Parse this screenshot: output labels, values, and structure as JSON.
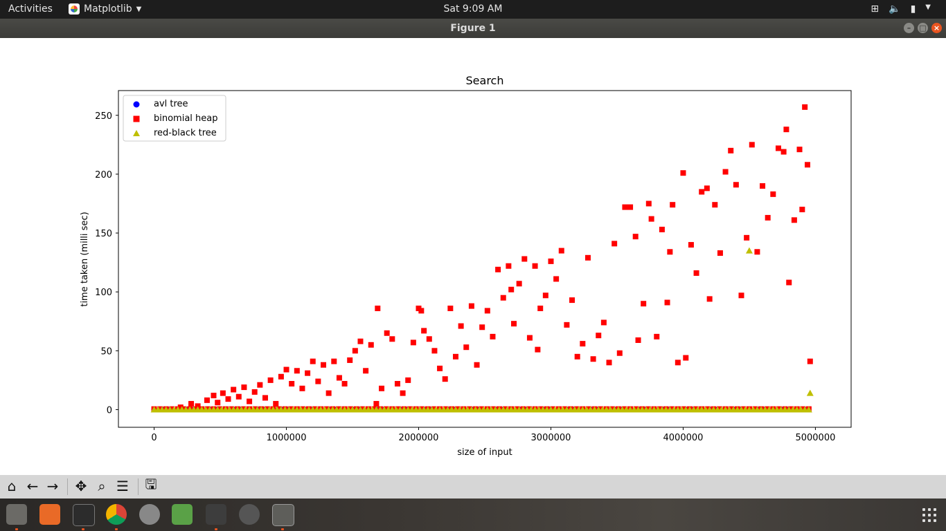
{
  "topbar": {
    "activities": "Activities",
    "app_name": "Matplotlib",
    "clock": "Sat  9:09 AM"
  },
  "window": {
    "title": "Figure 1"
  },
  "chart_data": {
    "type": "scatter",
    "title": "Search",
    "xlabel": "size of input",
    "ylabel": "time taken (milli sec)",
    "xlim": [
      -270000,
      5270000
    ],
    "ylim": [
      -15,
      271
    ],
    "xticks": [
      0,
      1000000,
      2000000,
      3000000,
      4000000,
      5000000
    ],
    "xtick_labels": [
      "0",
      "1000000",
      "2000000",
      "3000000",
      "4000000",
      "5000000"
    ],
    "yticks": [
      0,
      50,
      100,
      150,
      200,
      250
    ],
    "ytick_labels": [
      "0",
      "50",
      "100",
      "150",
      "200",
      "250"
    ],
    "grid": false,
    "legend_position": "top-left",
    "series": [
      {
        "name": "avl tree",
        "marker": "circle",
        "color": "#0000ff",
        "x_range": [
          0,
          4950000
        ],
        "y": 0
      },
      {
        "name": "binomial heap",
        "marker": "square",
        "color": "#ff0000",
        "points": [
          [
            200000,
            2
          ],
          [
            280000,
            5
          ],
          [
            330000,
            3
          ],
          [
            400000,
            8
          ],
          [
            450000,
            12
          ],
          [
            480000,
            6
          ],
          [
            520000,
            14
          ],
          [
            560000,
            9
          ],
          [
            600000,
            17
          ],
          [
            640000,
            11
          ],
          [
            680000,
            19
          ],
          [
            720000,
            7
          ],
          [
            760000,
            15
          ],
          [
            800000,
            21
          ],
          [
            840000,
            10
          ],
          [
            880000,
            25
          ],
          [
            920000,
            5
          ],
          [
            960000,
            28
          ],
          [
            1000000,
            34
          ],
          [
            1040000,
            22
          ],
          [
            1080000,
            33
          ],
          [
            1120000,
            18
          ],
          [
            1160000,
            31
          ],
          [
            1200000,
            41
          ],
          [
            1240000,
            24
          ],
          [
            1280000,
            38
          ],
          [
            1320000,
            14
          ],
          [
            1360000,
            41
          ],
          [
            1400000,
            27
          ],
          [
            1440000,
            22
          ],
          [
            1480000,
            42
          ],
          [
            1520000,
            50
          ],
          [
            1560000,
            58
          ],
          [
            1600000,
            33
          ],
          [
            1640000,
            55
          ],
          [
            1680000,
            5
          ],
          [
            1690000,
            86
          ],
          [
            1720000,
            18
          ],
          [
            1760000,
            65
          ],
          [
            1800000,
            60
          ],
          [
            1840000,
            22
          ],
          [
            1880000,
            14
          ],
          [
            1920000,
            25
          ],
          [
            1960000,
            57
          ],
          [
            2000000,
            86
          ],
          [
            2020000,
            84
          ],
          [
            2040000,
            67
          ],
          [
            2080000,
            60
          ],
          [
            2120000,
            50
          ],
          [
            2160000,
            35
          ],
          [
            2200000,
            26
          ],
          [
            2240000,
            86
          ],
          [
            2280000,
            45
          ],
          [
            2320000,
            71
          ],
          [
            2360000,
            53
          ],
          [
            2400000,
            88
          ],
          [
            2440000,
            38
          ],
          [
            2480000,
            70
          ],
          [
            2520000,
            84
          ],
          [
            2560000,
            62
          ],
          [
            2600000,
            119
          ],
          [
            2640000,
            95
          ],
          [
            2680000,
            122
          ],
          [
            2700000,
            102
          ],
          [
            2720000,
            73
          ],
          [
            2760000,
            107
          ],
          [
            2800000,
            128
          ],
          [
            2840000,
            61
          ],
          [
            2880000,
            122
          ],
          [
            2900000,
            51
          ],
          [
            2920000,
            86
          ],
          [
            2960000,
            97
          ],
          [
            3000000,
            126
          ],
          [
            3040000,
            111
          ],
          [
            3080000,
            135
          ],
          [
            3120000,
            72
          ],
          [
            3160000,
            93
          ],
          [
            3200000,
            45
          ],
          [
            3240000,
            56
          ],
          [
            3280000,
            129
          ],
          [
            3320000,
            43
          ],
          [
            3360000,
            63
          ],
          [
            3400000,
            74
          ],
          [
            3440000,
            40
          ],
          [
            3480000,
            141
          ],
          [
            3520000,
            48
          ],
          [
            3560000,
            172
          ],
          [
            3600000,
            172
          ],
          [
            3640000,
            147
          ],
          [
            3660000,
            59
          ],
          [
            3700000,
            90
          ],
          [
            3740000,
            175
          ],
          [
            3760000,
            162
          ],
          [
            3800000,
            62
          ],
          [
            3840000,
            153
          ],
          [
            3880000,
            91
          ],
          [
            3900000,
            134
          ],
          [
            3920000,
            174
          ],
          [
            3960000,
            40
          ],
          [
            4000000,
            201
          ],
          [
            4020000,
            44
          ],
          [
            4060000,
            140
          ],
          [
            4100000,
            116
          ],
          [
            4140000,
            185
          ],
          [
            4180000,
            188
          ],
          [
            4200000,
            94
          ],
          [
            4240000,
            174
          ],
          [
            4280000,
            133
          ],
          [
            4320000,
            202
          ],
          [
            4360000,
            220
          ],
          [
            4400000,
            191
          ],
          [
            4440000,
            97
          ],
          [
            4480000,
            146
          ],
          [
            4520000,
            225
          ],
          [
            4560000,
            134
          ],
          [
            4600000,
            190
          ],
          [
            4640000,
            163
          ],
          [
            4680000,
            183
          ],
          [
            4720000,
            222
          ],
          [
            4760000,
            219
          ],
          [
            4780000,
            238
          ],
          [
            4800000,
            108
          ],
          [
            4840000,
            161
          ],
          [
            4880000,
            221
          ],
          [
            4900000,
            170
          ],
          [
            4920000,
            257
          ],
          [
            4940000,
            208
          ],
          [
            4960000,
            41
          ]
        ]
      },
      {
        "name": "red-black tree",
        "marker": "triangle",
        "color": "#bfbf00",
        "x_range": [
          0,
          4950000
        ],
        "y": 0,
        "outliers": [
          [
            4500000,
            135
          ],
          [
            4960000,
            14
          ]
        ]
      }
    ]
  },
  "toolbar": {
    "home": "home-icon",
    "back": "arrow-left-icon",
    "forward": "arrow-right-icon",
    "pan": "move-icon",
    "zoom": "zoom-icon",
    "configure": "sliders-icon",
    "save": "save-icon"
  }
}
